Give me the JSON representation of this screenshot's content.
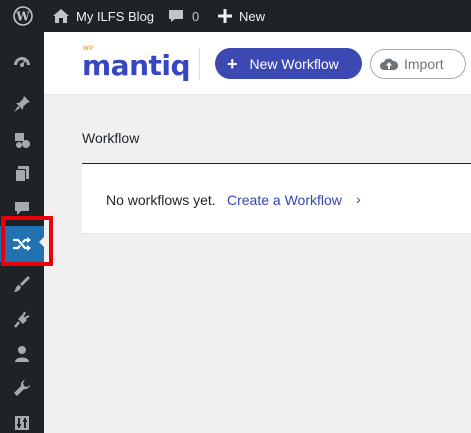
{
  "adminbar": {
    "wp_logo_icon": "wordpress-icon",
    "site_name": "My ILFS Blog",
    "site_icon": "home-icon",
    "comments_icon": "comment-bubble-icon",
    "comments_count": "0",
    "new_icon": "plus-icon",
    "new_label": "New"
  },
  "sidebar": {
    "items": [
      {
        "icon": "dashboard-gauge-icon"
      },
      {
        "icon": "pushpin-posts-icon"
      },
      {
        "icon": "media-icon"
      },
      {
        "icon": "pages-icon"
      },
      {
        "icon": "comments-icon"
      },
      {
        "icon": "shuffle-workflow-icon",
        "active": true
      },
      {
        "icon": "paintbrush-appearance-icon"
      },
      {
        "icon": "plugin-icon"
      },
      {
        "icon": "users-icon"
      },
      {
        "icon": "wrench-tools-icon"
      },
      {
        "icon": "settings-icon"
      }
    ],
    "active_color": "#2271b1",
    "highlight_color": "#e8000b"
  },
  "header": {
    "logo_small": "WP",
    "logo_main": "mantiq",
    "new_workflow_label": "New Workflow",
    "import_label": "Import",
    "brand_color": "#3d49b3",
    "logo_accent_color": "#f1a33b"
  },
  "main": {
    "title": "Workflow",
    "empty_text": "No workflows yet.",
    "create_link": "Create a Workflow",
    "chevron": "›"
  }
}
